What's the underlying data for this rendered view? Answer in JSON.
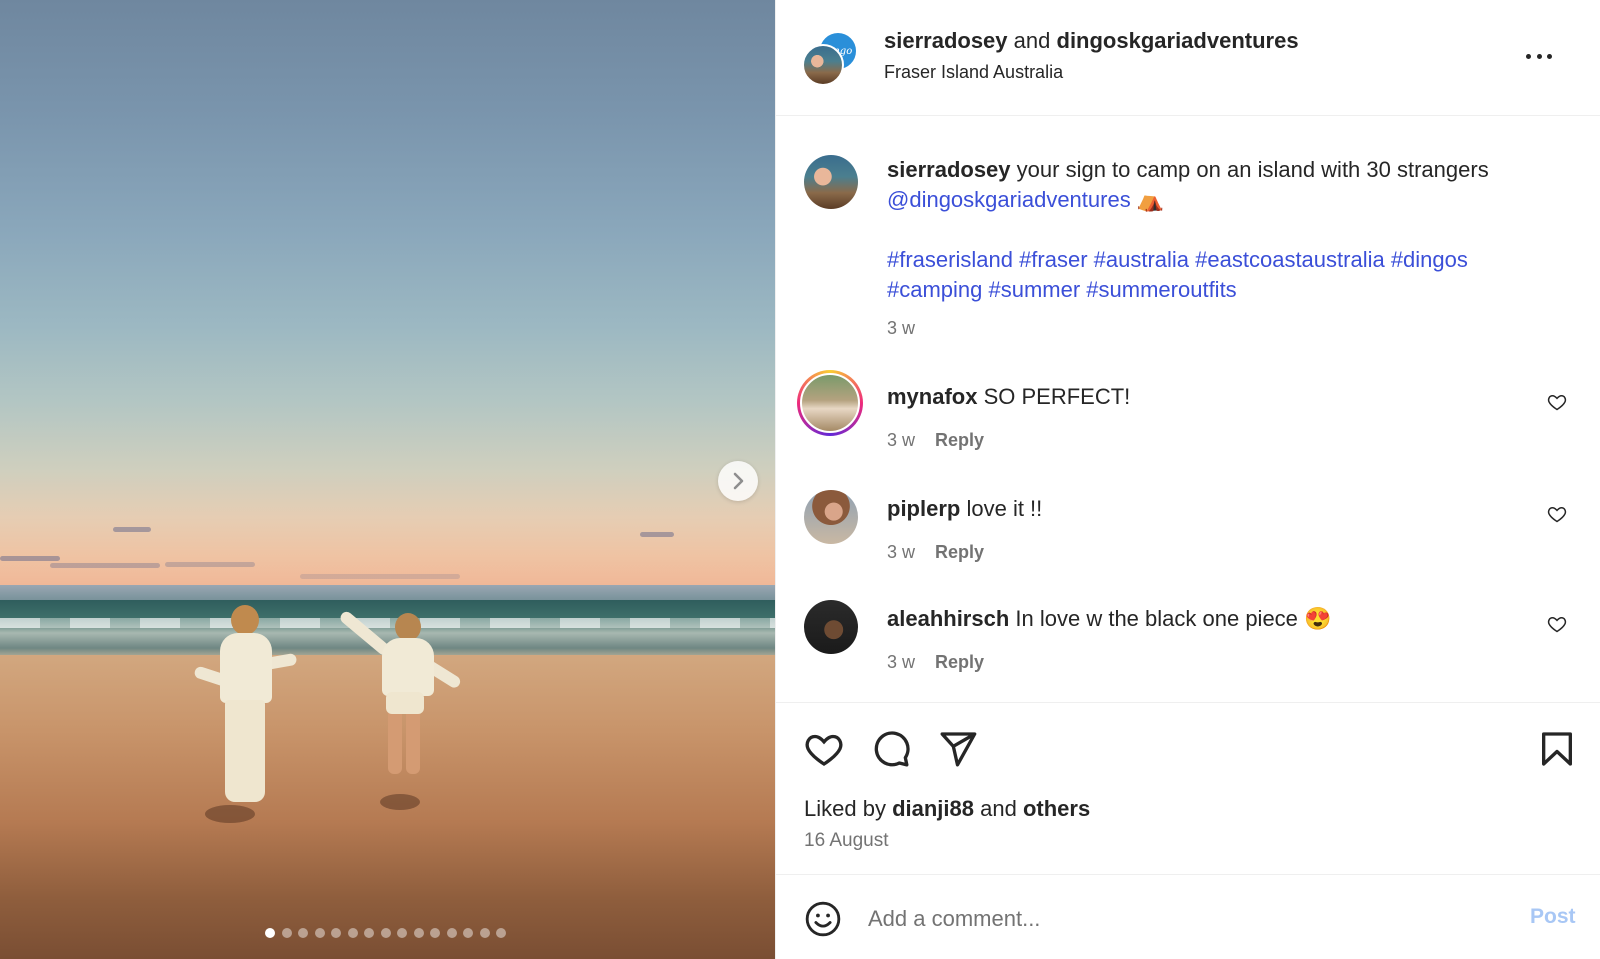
{
  "post": {
    "author": "sierradosey",
    "collab_joiner": "and",
    "collaborator": "dingoskgariadventures",
    "location": "Fraser Island Australia",
    "carousel": {
      "total_slides": 15,
      "active_index": 0
    }
  },
  "caption": {
    "username": "sierradosey",
    "text": "your sign to camp on an island with 30 strangers",
    "mention": "@dingoskgariadventures",
    "emoji": "⛺",
    "hashtags_line1": "#fraserisland #fraser #australia #eastcoastaustralia #dingos",
    "hashtags_line2": "#camping #summer #summeroutfits",
    "time": "3 w"
  },
  "comments": [
    {
      "username": "mynafox",
      "text": "SO PERFECT!",
      "time": "3 w",
      "reply": "Reply"
    },
    {
      "username": "piplerp",
      "text": "love it !!",
      "time": "3 w",
      "reply": "Reply"
    },
    {
      "username": "aleahhirsch",
      "text": "In love w the black one piece",
      "emoji": "😍",
      "time": "3 w",
      "reply": "Reply"
    }
  ],
  "likes": {
    "prefix": "Liked by",
    "user": "dianji88",
    "joiner": "and",
    "others": "others"
  },
  "post_date": "16 August",
  "comment_box": {
    "placeholder": "Add a comment...",
    "post_label": "Post"
  },
  "colors": {
    "link": "#3b4fd8",
    "post_button_disabled": "#a8c7f5",
    "muted_text": "#737373"
  },
  "icons": [
    "chevron-right-icon",
    "more-icon",
    "heart-icon",
    "comment-icon",
    "share-icon",
    "bookmark-icon",
    "emoji-icon"
  ]
}
